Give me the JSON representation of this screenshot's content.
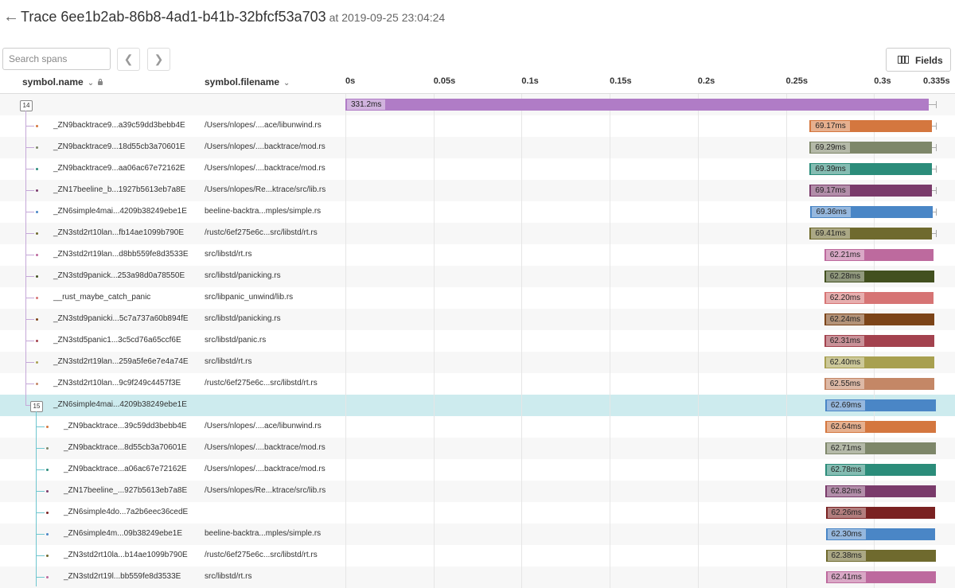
{
  "header": {
    "title": "Trace 6ee1b2ab-86b8-4ad1-b41b-32bfcf53a703",
    "timestamp": "at 2019-09-25 23:04:24"
  },
  "search": {
    "placeholder": "Search spans",
    "value": ""
  },
  "toolbar": {
    "fields_label": "Fields"
  },
  "columns": {
    "name": "symbol.name",
    "file": "symbol.filename"
  },
  "timeline": {
    "ticks": [
      "0s",
      "0.05s",
      "0.1s",
      "0.15s",
      "0.2s",
      "0.25s",
      "0.3s",
      "0.335s"
    ],
    "total_ms": 335
  },
  "colors": {
    "root": "#b07cc6",
    "selected_row": "#cdebee",
    "tree_line": "#c5a8d8",
    "tree_line_child": "#6fc6cf"
  },
  "rows": [
    {
      "name": "",
      "file": "",
      "badge": "14",
      "depth": 0,
      "start_ms": 0,
      "duration_ms": 331.2,
      "label": "331.2ms",
      "color": "#b07cc6",
      "selected": false
    },
    {
      "name": "_ZN9backtrace9...a39c59dd3bebb4E",
      "file": "/Users/nlopes/....ace/libunwind.rs",
      "badge": "",
      "depth": 1,
      "start_ms": 263.5,
      "duration_ms": 69.17,
      "label": "69.17ms",
      "color": "#d4773f",
      "dot": "#d4773f",
      "selected": false
    },
    {
      "name": "_ZN9backtrace9...18d55cb3a70601E",
      "file": "/Users/nlopes/....backtrace/mod.rs",
      "badge": "",
      "depth": 1,
      "start_ms": 263.5,
      "duration_ms": 69.29,
      "label": "69.29ms",
      "color": "#7e876a",
      "dot": "#7e876a",
      "selected": false
    },
    {
      "name": "_ZN9backtrace9...aa06ac67e72162E",
      "file": "/Users/nlopes/....backtrace/mod.rs",
      "badge": "",
      "depth": 1,
      "start_ms": 263.5,
      "duration_ms": 69.39,
      "label": "69.39ms",
      "color": "#2b8c7a",
      "dot": "#2b8c7a",
      "selected": false
    },
    {
      "name": "_ZN17beeline_b...1927b5613eb7a8E",
      "file": "/Users/nlopes/Re...ktrace/src/lib.rs",
      "badge": "",
      "depth": 1,
      "start_ms": 263.5,
      "duration_ms": 69.17,
      "label": "69.17ms",
      "color": "#7a3b6b",
      "dot": "#7a3b6b",
      "selected": false
    },
    {
      "name": "_ZN6simple4mai...4209b38249ebe1E",
      "file": "beeline-backtra...mples/simple.rs",
      "badge": "",
      "depth": 1,
      "start_ms": 264.0,
      "duration_ms": 69.36,
      "label": "69.36ms",
      "color": "#4a86c6",
      "dot": "#4a86c6",
      "selected": false
    },
    {
      "name": "_ZN3std2rt10lan...fb14ae1099b790E",
      "file": "/rustc/6ef275e6c...src/libstd/rt.rs",
      "badge": "",
      "depth": 1,
      "start_ms": 263.5,
      "duration_ms": 69.41,
      "label": "69.41ms",
      "color": "#6f6a2e",
      "dot": "#6f6a2e",
      "selected": false
    },
    {
      "name": "_ZN3std2rt19lan...d8bb559fe8d3533E",
      "file": "src/libstd/rt.rs",
      "badge": "",
      "depth": 1,
      "start_ms": 271.8,
      "duration_ms": 62.21,
      "label": "62.21ms",
      "color": "#bd6a9e",
      "dot": "#bd6a9e",
      "selected": false
    },
    {
      "name": "_ZN3std9panick...253a98d0a78550E",
      "file": "src/libstd/panicking.rs",
      "badge": "",
      "depth": 1,
      "start_ms": 271.8,
      "duration_ms": 62.28,
      "label": "62.28ms",
      "color": "#42501f",
      "dot": "#42501f",
      "selected": false
    },
    {
      "name": "__rust_maybe_catch_panic",
      "file": "src/libpanic_unwind/lib.rs",
      "badge": "",
      "depth": 1,
      "start_ms": 271.8,
      "duration_ms": 62.2,
      "label": "62.20ms",
      "color": "#d67474",
      "dot": "#d67474",
      "selected": false
    },
    {
      "name": "_ZN3std9panicki...5c7a737a60b894fE",
      "file": "src/libstd/panicking.rs",
      "badge": "",
      "depth": 1,
      "start_ms": 271.8,
      "duration_ms": 62.24,
      "label": "62.24ms",
      "color": "#7c4418",
      "dot": "#7c4418",
      "selected": false
    },
    {
      "name": "_ZN3std5panic1...3c5cd76a65ccf6E",
      "file": "src/libstd/panic.rs",
      "badge": "",
      "depth": 1,
      "start_ms": 271.8,
      "duration_ms": 62.31,
      "label": "62.31ms",
      "color": "#a3424e",
      "dot": "#a3424e",
      "selected": false
    },
    {
      "name": "_ZN3std2rt19lan...259a5fe6e7e4a74E",
      "file": "src/libstd/rt.rs",
      "badge": "",
      "depth": 1,
      "start_ms": 271.8,
      "duration_ms": 62.4,
      "label": "62.40ms",
      "color": "#a8a050",
      "dot": "#a8a050",
      "selected": false
    },
    {
      "name": "_ZN3std2rt10lan...9c9f249c4457f3E",
      "file": "/rustc/6ef275e6c...src/libstd/rt.rs",
      "badge": "",
      "depth": 1,
      "start_ms": 271.8,
      "duration_ms": 62.55,
      "label": "62.55ms",
      "color": "#c48766",
      "dot": "#c48766",
      "selected": false
    },
    {
      "name": "_ZN6simple4mai...4209b38249ebe1E",
      "file": "",
      "badge": "15",
      "depth": 1,
      "start_ms": 272.3,
      "duration_ms": 62.69,
      "label": "62.69ms",
      "color": "#4a86c6",
      "selected": true
    },
    {
      "name": "_ZN9backtrace...39c59dd3bebb4E",
      "file": "/Users/nlopes/....ace/libunwind.rs",
      "badge": "",
      "depth": 2,
      "start_ms": 272.3,
      "duration_ms": 62.64,
      "label": "62.64ms",
      "color": "#d4773f",
      "dot": "#d4773f",
      "selected": false
    },
    {
      "name": "_ZN9backtrace...8d55cb3a70601E",
      "file": "/Users/nlopes/....backtrace/mod.rs",
      "badge": "",
      "depth": 2,
      "start_ms": 272.3,
      "duration_ms": 62.71,
      "label": "62.71ms",
      "color": "#7e876a",
      "dot": "#7e876a",
      "selected": false
    },
    {
      "name": "_ZN9backtrace...a06ac67e72162E",
      "file": "/Users/nlopes/....backtrace/mod.rs",
      "badge": "",
      "depth": 2,
      "start_ms": 272.3,
      "duration_ms": 62.78,
      "label": "62.78ms",
      "color": "#2b8c7a",
      "dot": "#2b8c7a",
      "selected": false
    },
    {
      "name": "_ZN17beeline_...927b5613eb7a8E",
      "file": "/Users/nlopes/Re...ktrace/src/lib.rs",
      "badge": "",
      "depth": 2,
      "start_ms": 272.3,
      "duration_ms": 62.82,
      "label": "62.82ms",
      "color": "#7a3b6b",
      "dot": "#7a3b6b",
      "selected": false
    },
    {
      "name": "_ZN6simple4do...7a2b6eec36cedE",
      "file": "",
      "badge": "",
      "depth": 2,
      "start_ms": 272.6,
      "duration_ms": 62.26,
      "label": "62.26ms",
      "color": "#7a2222",
      "dot": "#7a2222",
      "selected": false
    },
    {
      "name": "_ZN6simple4m...09b38249ebe1E",
      "file": "beeline-backtra...mples/simple.rs",
      "badge": "",
      "depth": 2,
      "start_ms": 272.6,
      "duration_ms": 62.3,
      "label": "62.30ms",
      "color": "#4a86c6",
      "dot": "#4a86c6",
      "selected": false
    },
    {
      "name": "_ZN3std2rt10la...b14ae1099b790E",
      "file": "/rustc/6ef275e6c...src/libstd/rt.rs",
      "badge": "",
      "depth": 2,
      "start_ms": 272.6,
      "duration_ms": 62.38,
      "label": "62.38ms",
      "color": "#6f6a2e",
      "dot": "#6f6a2e",
      "selected": false
    },
    {
      "name": "_ZN3std2rt19l...bb559fe8d3533E",
      "file": "src/libstd/rt.rs",
      "badge": "",
      "depth": 2,
      "start_ms": 272.6,
      "duration_ms": 62.41,
      "label": "62.41ms",
      "color": "#bd6a9e",
      "dot": "#bd6a9e",
      "selected": false
    }
  ]
}
